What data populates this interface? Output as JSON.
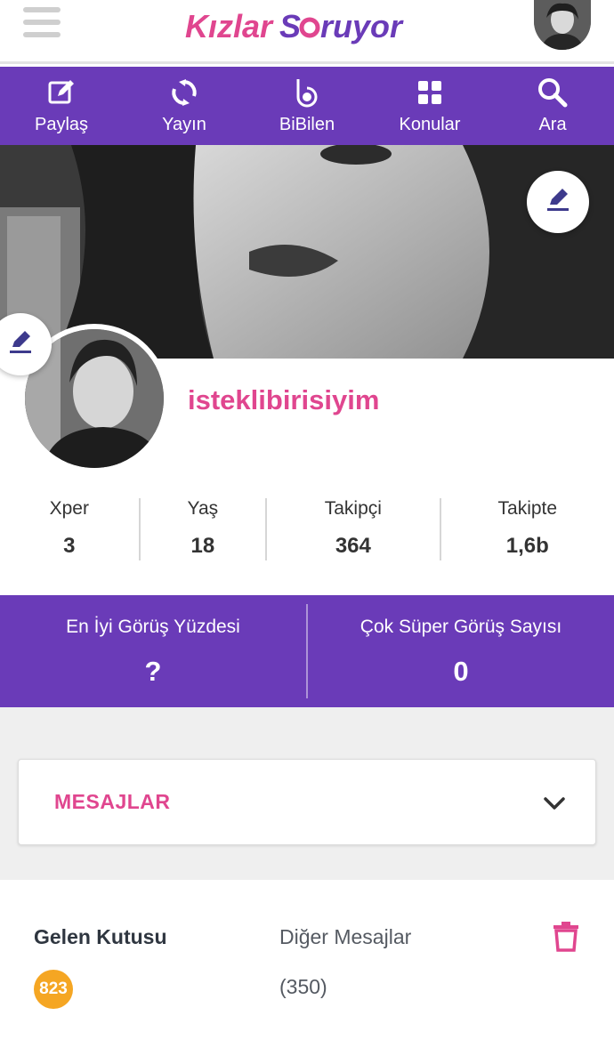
{
  "header": {
    "logo_part1": "Kızlar",
    "logo_part2": "S",
    "logo_part3": "ruyor",
    "logo_colors": {
      "pink": "#e0468f",
      "purple": "#6a3bb8"
    }
  },
  "nav": {
    "items": [
      {
        "label": "Paylaş",
        "icon": "edit-icon"
      },
      {
        "label": "Yayın",
        "icon": "refresh-icon"
      },
      {
        "label": "BiBilen",
        "icon": "bibilen-icon"
      },
      {
        "label": "Konular",
        "icon": "grid-icon"
      },
      {
        "label": "Ara",
        "icon": "search-icon"
      }
    ]
  },
  "profile": {
    "username": "isteklibirisiyim"
  },
  "stats": [
    {
      "label": "Xper",
      "value": "3"
    },
    {
      "label": "Yaş",
      "value": "18"
    },
    {
      "label": "Takipçi",
      "value": "364"
    },
    {
      "label": "Takipte",
      "value": "1,6b"
    }
  ],
  "summary": {
    "best_label": "En İyi Görüş Yüzdesi",
    "best_value": "?",
    "super_label": "Çok Süper Görüş Sayısı",
    "super_value": "0"
  },
  "messages": {
    "title": "MESAJLAR",
    "inbox_label": "Gelen Kutusu",
    "inbox_count": "823",
    "other_label": "Diğer Mesajlar",
    "other_count": "(350)"
  },
  "colors": {
    "brand_purple": "#6a3bb8",
    "brand_pink": "#e0468f",
    "badge_orange": "#f5a623"
  }
}
